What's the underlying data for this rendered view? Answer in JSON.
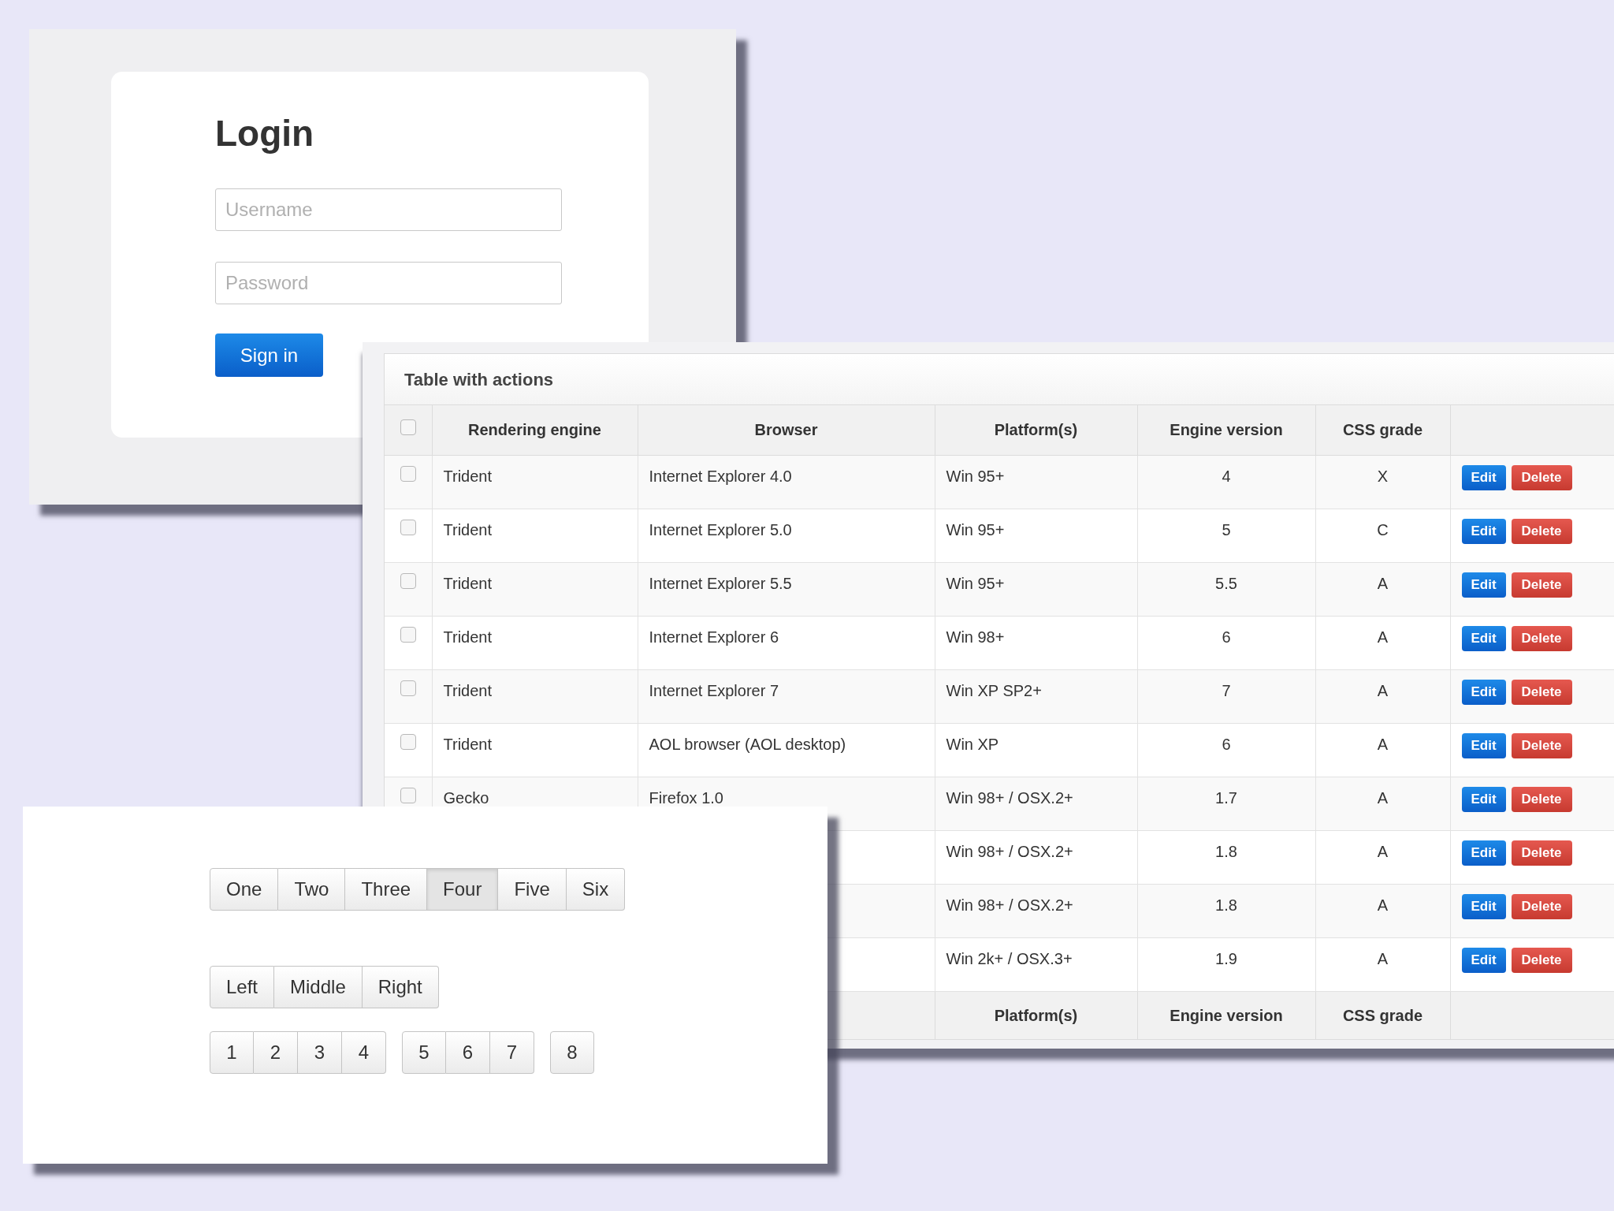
{
  "login": {
    "title": "Login",
    "username": {
      "placeholder": "Username"
    },
    "password": {
      "placeholder": "Password"
    },
    "submit": "Sign in"
  },
  "table": {
    "title": "Table with actions",
    "header_checked": false,
    "columns": [
      "Rendering engine",
      "Browser",
      "Platform(s)",
      "Engine version",
      "CSS grade"
    ],
    "rows": [
      {
        "checked": false,
        "engine": "Trident",
        "browser": "Internet Explorer 4.0",
        "platform": "Win 95+",
        "version": "4",
        "grade": "X",
        "actions": [
          "Edit",
          "Delete"
        ]
      },
      {
        "checked": false,
        "engine": "Trident",
        "browser": "Internet Explorer 5.0",
        "platform": "Win 95+",
        "version": "5",
        "grade": "C",
        "actions": [
          "Edit",
          "Delete"
        ]
      },
      {
        "checked": false,
        "engine": "Trident",
        "browser": "Internet Explorer 5.5",
        "platform": "Win 95+",
        "version": "5.5",
        "grade": "A",
        "actions": [
          "Edit",
          "Delete"
        ]
      },
      {
        "checked": false,
        "engine": "Trident",
        "browser": "Internet Explorer 6",
        "platform": "Win 98+",
        "version": "6",
        "grade": "A",
        "actions": [
          "Edit",
          "Delete"
        ]
      },
      {
        "checked": false,
        "engine": "Trident",
        "browser": "Internet Explorer 7",
        "platform": "Win XP SP2+",
        "version": "7",
        "grade": "A",
        "actions": [
          "Edit",
          "Delete"
        ]
      },
      {
        "checked": false,
        "engine": "Trident",
        "browser": "AOL browser (AOL desktop)",
        "platform": "Win XP",
        "version": "6",
        "grade": "A",
        "actions": [
          "Edit",
          "Delete"
        ]
      },
      {
        "checked": false,
        "engine": "Gecko",
        "browser": "Firefox 1.0",
        "platform": "Win 98+ / OSX.2+",
        "version": "1.7",
        "grade": "A",
        "actions": [
          "Edit",
          "Delete"
        ]
      },
      {
        "platform": "Win 98+ / OSX.2+",
        "version": "1.8",
        "grade": "A",
        "actions": [
          "Edit",
          "Delete"
        ]
      },
      {
        "platform": "Win 98+ / OSX.2+",
        "version": "1.8",
        "grade": "A",
        "actions": [
          "Edit",
          "Delete"
        ]
      },
      {
        "platform": "Win 2k+ / OSX.3+",
        "version": "1.9",
        "grade": "A",
        "actions": [
          "Edit",
          "Delete"
        ]
      }
    ],
    "footer": [
      "Platform(s)",
      "Engine version",
      "CSS grade"
    ]
  },
  "button_groups": [
    [
      {
        "label": "One",
        "selected": false
      },
      {
        "label": "Two",
        "selected": false
      },
      {
        "label": "Three",
        "selected": false
      },
      {
        "label": "Four",
        "selected": true
      },
      {
        "label": "Five",
        "selected": false
      },
      {
        "label": "Six",
        "selected": false
      }
    ],
    [
      {
        "label": "Left",
        "selected": false
      },
      {
        "label": "Middle",
        "selected": false
      },
      {
        "label": "Right",
        "selected": false
      }
    ]
  ],
  "number_groups": [
    [
      "1",
      "2",
      "3",
      "4"
    ],
    [
      "5",
      "6",
      "7"
    ],
    [
      "8"
    ]
  ]
}
